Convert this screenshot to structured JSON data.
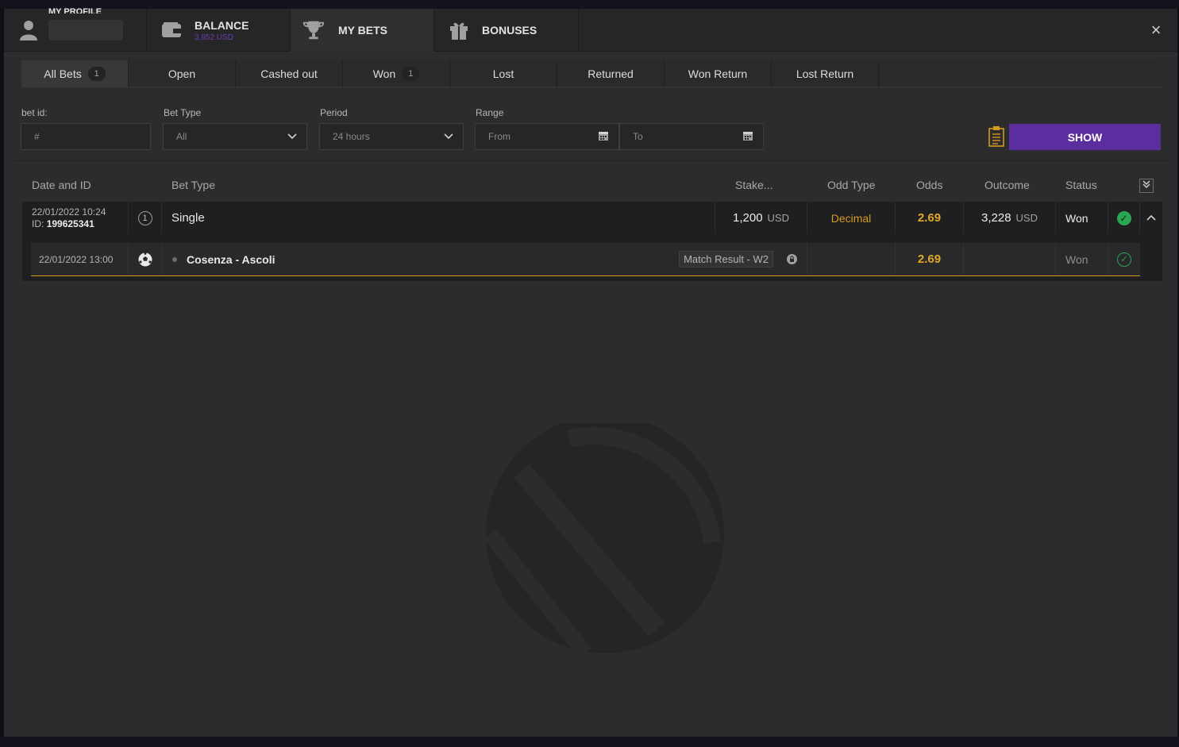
{
  "top_tabs": [
    {
      "id": "profile",
      "label": "MY PROFILE",
      "sub": ""
    },
    {
      "id": "balance",
      "label": "BALANCE",
      "sub": "3,952 USD"
    },
    {
      "id": "mybets",
      "label": "MY BETS",
      "sub": ""
    },
    {
      "id": "bonuses",
      "label": "BONUSES",
      "sub": ""
    }
  ],
  "close_label": "×",
  "filter_tabs": [
    {
      "label": "All Bets",
      "count": "1"
    },
    {
      "label": "Open",
      "count": ""
    },
    {
      "label": "Cashed out",
      "count": ""
    },
    {
      "label": "Won",
      "count": "1"
    },
    {
      "label": "Lost",
      "count": ""
    },
    {
      "label": "Returned",
      "count": ""
    },
    {
      "label": "Won Return",
      "count": ""
    },
    {
      "label": "Lost Return",
      "count": ""
    }
  ],
  "filters": {
    "bet_id_label": "bet id:",
    "bet_id_placeholder": "#",
    "bet_type_label": "Bet Type",
    "bet_type_value": "All",
    "period_label": "Period",
    "period_value": "24 hours",
    "range_label": "Range",
    "range_from": "From",
    "range_to": "To",
    "show_label": "SHOW"
  },
  "columns": {
    "date_id": "Date and ID",
    "bet_type": "Bet Type",
    "stake": "Stake...",
    "odd_type": "Odd Type",
    "odds": "Odds",
    "outcome": "Outcome",
    "status": "Status"
  },
  "bet": {
    "date": "22/01/2022 10:24",
    "id_label": "ID:",
    "id": "199625341",
    "num": "1",
    "type": "Single",
    "stake": "1,200",
    "currency": "USD",
    "odd_type": "Decimal",
    "odds": "2.69",
    "outcome": "3,228",
    "outcome_currency": "USD",
    "status": "Won",
    "selection": {
      "date": "22/01/2022 13:00",
      "event": "Cosenza - Ascoli",
      "market": "Match Result - W2",
      "odds": "2.69",
      "status": "Won"
    }
  },
  "colors": {
    "accent": "#5b2d9e",
    "gold": "#d49a1c",
    "success": "#2aa551"
  }
}
